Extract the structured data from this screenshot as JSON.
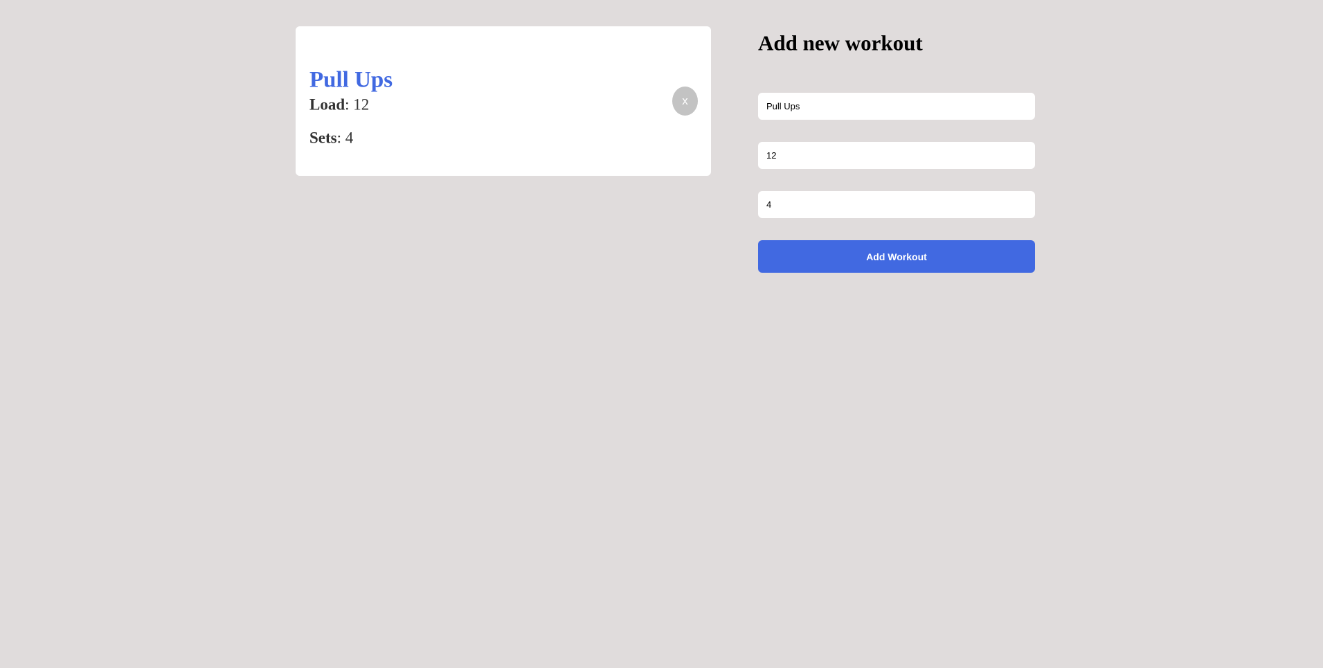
{
  "workout_card": {
    "title": "Pull Ups",
    "load_label": "Load",
    "load_value": "12",
    "sets_label": "Sets",
    "sets_value": "4",
    "delete_label": "x"
  },
  "form": {
    "title": "Add new workout",
    "title_input_value": "Pull Ups",
    "load_input_value": "12",
    "sets_input_value": "4",
    "submit_label": "Add Workout"
  },
  "colors": {
    "background": "#e0dcdc",
    "accent": "#4169e1",
    "card": "#ffffff",
    "delete_button": "#c3c3c3"
  }
}
